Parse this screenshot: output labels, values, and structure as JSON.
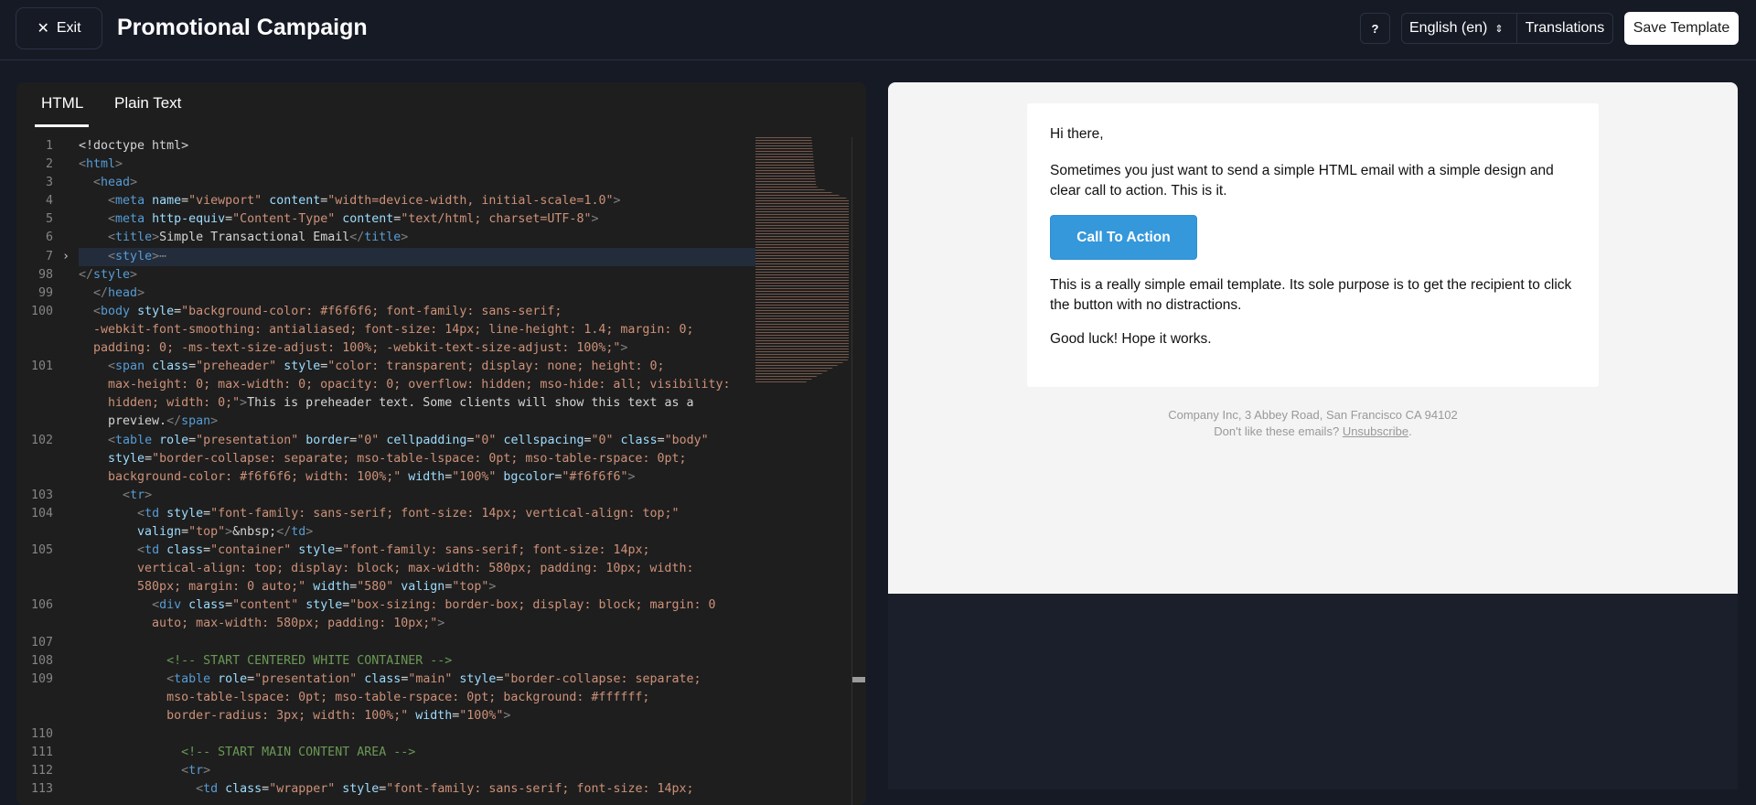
{
  "header": {
    "exit_label": "Exit",
    "title": "Promotional Campaign",
    "help_label": "?",
    "language": "English (en)",
    "translations_label": "Translations",
    "save_label": "Save Template"
  },
  "editor": {
    "tabs": [
      {
        "label": "HTML",
        "active": true
      },
      {
        "label": "Plain Text",
        "active": false
      }
    ],
    "rows": [
      {
        "n": "1",
        "t": [
          [
            "x",
            "<!doctype html>"
          ]
        ]
      },
      {
        "n": "2",
        "t": [
          [
            "p",
            "<"
          ],
          [
            "t",
            "html"
          ],
          [
            "p",
            ">"
          ]
        ]
      },
      {
        "n": "3",
        "t": [
          [
            "x",
            "  "
          ],
          [
            "p",
            "<"
          ],
          [
            "t",
            "head"
          ],
          [
            "p",
            ">"
          ]
        ]
      },
      {
        "n": "4",
        "t": [
          [
            "x",
            "    "
          ],
          [
            "p",
            "<"
          ],
          [
            "t",
            "meta "
          ],
          [
            "a",
            "name"
          ],
          [
            "x",
            "="
          ],
          [
            "s",
            "\"viewport\" "
          ],
          [
            "a",
            "content"
          ],
          [
            "x",
            "="
          ],
          [
            "s",
            "\"width=device-width, initial-scale=1.0\""
          ],
          [
            "p",
            ">"
          ]
        ]
      },
      {
        "n": "5",
        "t": [
          [
            "x",
            "    "
          ],
          [
            "p",
            "<"
          ],
          [
            "t",
            "meta "
          ],
          [
            "a",
            "http-equiv"
          ],
          [
            "x",
            "="
          ],
          [
            "s",
            "\"Content-Type\" "
          ],
          [
            "a",
            "content"
          ],
          [
            "x",
            "="
          ],
          [
            "s",
            "\"text/html; charset=UTF-8\""
          ],
          [
            "p",
            ">"
          ]
        ]
      },
      {
        "n": "6",
        "t": [
          [
            "x",
            "    "
          ],
          [
            "p",
            "<"
          ],
          [
            "t",
            "title"
          ],
          [
            "p",
            ">"
          ],
          [
            "x",
            "Simple Transactional Email"
          ],
          [
            "p",
            "</"
          ],
          [
            "t",
            "title"
          ],
          [
            "p",
            ">"
          ]
        ]
      },
      {
        "n": "7",
        "fold": "›",
        "hl": true,
        "t": [
          [
            "x",
            "    "
          ],
          [
            "p",
            "<"
          ],
          [
            "t",
            "style"
          ],
          [
            "p",
            ">"
          ],
          [
            "p",
            "⋯"
          ]
        ]
      },
      {
        "n": "98",
        "t": [
          [
            "p",
            "</"
          ],
          [
            "t",
            "style"
          ],
          [
            "p",
            ">"
          ]
        ]
      },
      {
        "n": "99",
        "t": [
          [
            "x",
            "  "
          ],
          [
            "p",
            "</"
          ],
          [
            "t",
            "head"
          ],
          [
            "p",
            ">"
          ]
        ]
      },
      {
        "n": "100",
        "t": [
          [
            "x",
            "  "
          ],
          [
            "p",
            "<"
          ],
          [
            "t",
            "body "
          ],
          [
            "a",
            "style"
          ],
          [
            "x",
            "="
          ],
          [
            "s",
            "\"background-color: #f6f6f6; font-family: sans-serif;"
          ]
        ]
      },
      {
        "n": "",
        "t": [
          [
            "s",
            "  -webkit-font-smoothing: antialiased; font-size: 14px; line-height: 1.4; margin: 0;"
          ]
        ]
      },
      {
        "n": "",
        "t": [
          [
            "s",
            "  padding: 0; -ms-text-size-adjust: 100%; -webkit-text-size-adjust: 100%;\""
          ],
          [
            "p",
            ">"
          ]
        ]
      },
      {
        "n": "101",
        "t": [
          [
            "x",
            "    "
          ],
          [
            "p",
            "<"
          ],
          [
            "t",
            "span "
          ],
          [
            "a",
            "class"
          ],
          [
            "x",
            "="
          ],
          [
            "s",
            "\"preheader\" "
          ],
          [
            "a",
            "style"
          ],
          [
            "x",
            "="
          ],
          [
            "s",
            "\"color: transparent; display: none; height: 0;"
          ]
        ]
      },
      {
        "n": "",
        "t": [
          [
            "s",
            "    max-height: 0; max-width: 0; opacity: 0; overflow: hidden; mso-hide: all; visibility:"
          ]
        ]
      },
      {
        "n": "",
        "t": [
          [
            "s",
            "    hidden; width: 0;\""
          ],
          [
            "p",
            ">"
          ],
          [
            "x",
            "This is preheader text. Some clients will show this text as a"
          ]
        ]
      },
      {
        "n": "",
        "t": [
          [
            "x",
            "    preview."
          ],
          [
            "p",
            "</"
          ],
          [
            "t",
            "span"
          ],
          [
            "p",
            ">"
          ]
        ]
      },
      {
        "n": "102",
        "t": [
          [
            "x",
            "    "
          ],
          [
            "p",
            "<"
          ],
          [
            "t",
            "table "
          ],
          [
            "a",
            "role"
          ],
          [
            "x",
            "="
          ],
          [
            "s",
            "\"presentation\" "
          ],
          [
            "a",
            "border"
          ],
          [
            "x",
            "="
          ],
          [
            "s",
            "\"0\" "
          ],
          [
            "a",
            "cellpadding"
          ],
          [
            "x",
            "="
          ],
          [
            "s",
            "\"0\" "
          ],
          [
            "a",
            "cellspacing"
          ],
          [
            "x",
            "="
          ],
          [
            "s",
            "\"0\" "
          ],
          [
            "a",
            "class"
          ],
          [
            "x",
            "="
          ],
          [
            "s",
            "\"body\""
          ]
        ]
      },
      {
        "n": "",
        "t": [
          [
            "x",
            "    "
          ],
          [
            "a",
            "style"
          ],
          [
            "x",
            "="
          ],
          [
            "s",
            "\"border-collapse: separate; mso-table-lspace: 0pt; mso-table-rspace: 0pt;"
          ]
        ]
      },
      {
        "n": "",
        "t": [
          [
            "s",
            "    background-color: #f6f6f6; width: 100%;\" "
          ],
          [
            "a",
            "width"
          ],
          [
            "x",
            "="
          ],
          [
            "s",
            "\"100%\" "
          ],
          [
            "a",
            "bgcolor"
          ],
          [
            "x",
            "="
          ],
          [
            "s",
            "\"#f6f6f6\""
          ],
          [
            "p",
            ">"
          ]
        ]
      },
      {
        "n": "103",
        "t": [
          [
            "x",
            "      "
          ],
          [
            "p",
            "<"
          ],
          [
            "t",
            "tr"
          ],
          [
            "p",
            ">"
          ]
        ]
      },
      {
        "n": "104",
        "t": [
          [
            "x",
            "        "
          ],
          [
            "p",
            "<"
          ],
          [
            "t",
            "td "
          ],
          [
            "a",
            "style"
          ],
          [
            "x",
            "="
          ],
          [
            "s",
            "\"font-family: sans-serif; font-size: 14px; vertical-align: top;\""
          ]
        ]
      },
      {
        "n": "",
        "t": [
          [
            "x",
            "        "
          ],
          [
            "a",
            "valign"
          ],
          [
            "x",
            "="
          ],
          [
            "s",
            "\"top\""
          ],
          [
            "p",
            ">"
          ],
          [
            "x",
            "&nbsp;"
          ],
          [
            "p",
            "</"
          ],
          [
            "t",
            "td"
          ],
          [
            "p",
            ">"
          ]
        ]
      },
      {
        "n": "105",
        "t": [
          [
            "x",
            "        "
          ],
          [
            "p",
            "<"
          ],
          [
            "t",
            "td "
          ],
          [
            "a",
            "class"
          ],
          [
            "x",
            "="
          ],
          [
            "s",
            "\"container\" "
          ],
          [
            "a",
            "style"
          ],
          [
            "x",
            "="
          ],
          [
            "s",
            "\"font-family: sans-serif; font-size: 14px;"
          ]
        ]
      },
      {
        "n": "",
        "t": [
          [
            "s",
            "        vertical-align: top; display: block; max-width: 580px; padding: 10px; width:"
          ]
        ]
      },
      {
        "n": "",
        "t": [
          [
            "s",
            "        580px; margin: 0 auto;\" "
          ],
          [
            "a",
            "width"
          ],
          [
            "x",
            "="
          ],
          [
            "s",
            "\"580\" "
          ],
          [
            "a",
            "valign"
          ],
          [
            "x",
            "="
          ],
          [
            "s",
            "\"top\""
          ],
          [
            "p",
            ">"
          ]
        ]
      },
      {
        "n": "106",
        "t": [
          [
            "x",
            "          "
          ],
          [
            "p",
            "<"
          ],
          [
            "t",
            "div "
          ],
          [
            "a",
            "class"
          ],
          [
            "x",
            "="
          ],
          [
            "s",
            "\"content\" "
          ],
          [
            "a",
            "style"
          ],
          [
            "x",
            "="
          ],
          [
            "s",
            "\"box-sizing: border-box; display: block; margin: 0"
          ]
        ]
      },
      {
        "n": "",
        "t": [
          [
            "s",
            "          auto; max-width: 580px; padding: 10px;\""
          ],
          [
            "p",
            ">"
          ]
        ]
      },
      {
        "n": "107",
        "t": []
      },
      {
        "n": "108",
        "t": [
          [
            "x",
            "            "
          ],
          [
            "c",
            "<!-- START CENTERED WHITE CONTAINER -->"
          ]
        ]
      },
      {
        "n": "109",
        "t": [
          [
            "x",
            "            "
          ],
          [
            "p",
            "<"
          ],
          [
            "t",
            "table "
          ],
          [
            "a",
            "role"
          ],
          [
            "x",
            "="
          ],
          [
            "s",
            "\"presentation\" "
          ],
          [
            "a",
            "class"
          ],
          [
            "x",
            "="
          ],
          [
            "s",
            "\"main\" "
          ],
          [
            "a",
            "style"
          ],
          [
            "x",
            "="
          ],
          [
            "s",
            "\"border-collapse: separate;"
          ]
        ]
      },
      {
        "n": "",
        "t": [
          [
            "s",
            "            mso-table-lspace: 0pt; mso-table-rspace: 0pt; background: #ffffff;"
          ]
        ]
      },
      {
        "n": "",
        "t": [
          [
            "s",
            "            border-radius: 3px; width: 100%;\" "
          ],
          [
            "a",
            "width"
          ],
          [
            "x",
            "="
          ],
          [
            "s",
            "\"100%\""
          ],
          [
            "p",
            ">"
          ]
        ]
      },
      {
        "n": "110",
        "t": []
      },
      {
        "n": "111",
        "t": [
          [
            "x",
            "              "
          ],
          [
            "c",
            "<!-- START MAIN CONTENT AREA -->"
          ]
        ]
      },
      {
        "n": "112",
        "t": [
          [
            "x",
            "              "
          ],
          [
            "p",
            "<"
          ],
          [
            "t",
            "tr"
          ],
          [
            "p",
            ">"
          ]
        ]
      },
      {
        "n": "113",
        "t": [
          [
            "x",
            "                "
          ],
          [
            "p",
            "<"
          ],
          [
            "t",
            "td "
          ],
          [
            "a",
            "class"
          ],
          [
            "x",
            "="
          ],
          [
            "s",
            "\"wrapper\" "
          ],
          [
            "a",
            "style"
          ],
          [
            "x",
            "="
          ],
          [
            "s",
            "\"font-family: sans-serif; font-size: 14px;"
          ]
        ]
      }
    ]
  },
  "preview": {
    "greeting": "Hi there,",
    "para1": "Sometimes you just want to send a simple HTML email with a simple design and clear call to action. This is it.",
    "cta_label": "Call To Action",
    "para2": "This is a really simple email template. Its sole purpose is to get the recipient to click the button with no distractions.",
    "para3": "Good luck! Hope it works.",
    "footer_address": "Company Inc, 3 Abbey Road, San Francisco CA 94102",
    "footer_prompt": "Don't like these emails?",
    "unsubscribe_label": "Unsubscribe",
    "footer_period": ".",
    "cta_color": "#3498db"
  }
}
